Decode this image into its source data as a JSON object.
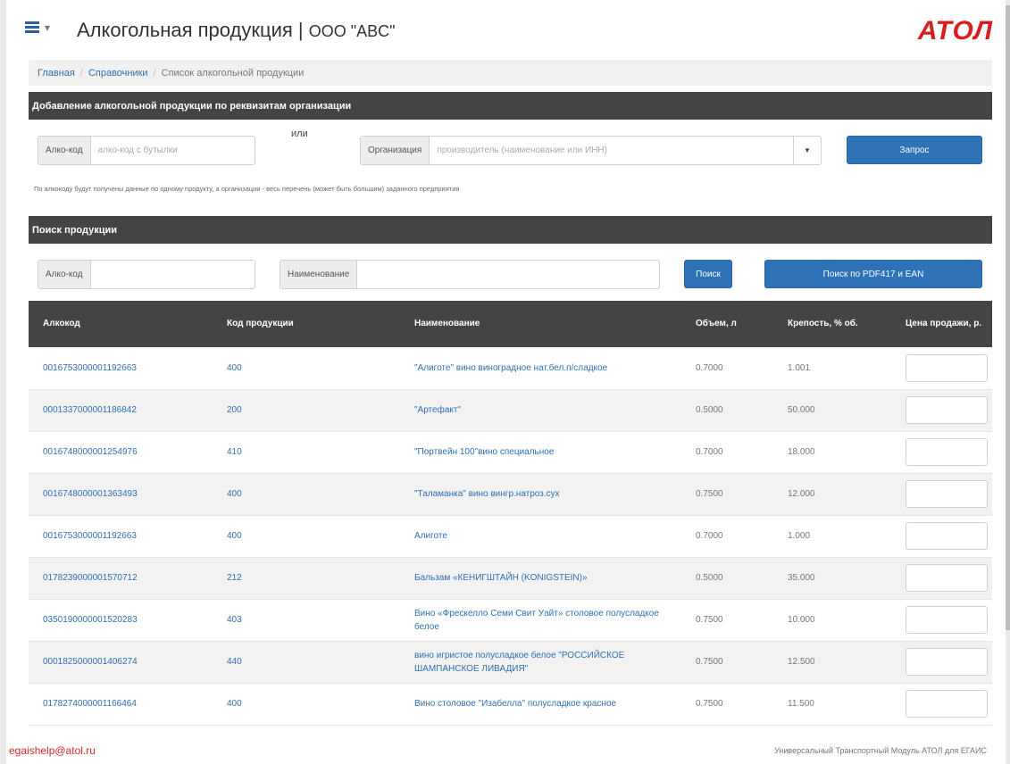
{
  "header": {
    "menu_chevron": "▾",
    "title": "Алкогольная продукция |",
    "org": "ООО \"ABC\"",
    "logo": "АТОЛ"
  },
  "breadcrumb": {
    "items": [
      "Главная",
      "Справочники",
      "Список алкогольной продукции"
    ],
    "separator": "/"
  },
  "add_section": {
    "title": "Добавление алкогольной продукции по реквизитам организации",
    "alco_label": "Алко-код",
    "alco_placeholder": "алко-код с бутылки",
    "or_text": "или",
    "org_label": "Организация",
    "org_placeholder": "производитель (наименование или ИНН)",
    "request_button": "Запрос",
    "hint": "По алкокоду будут получены данные по одному продукту, а организации - весь перечень (может быть большим) заданного предприятия"
  },
  "search_section": {
    "title": "Поиск продукции",
    "alco_label": "Алко-код",
    "alco_value": "",
    "name_label": "Наименование",
    "name_value": "",
    "search_button": "Поиск",
    "pdf_button": "Поиск по PDF417 и EAN"
  },
  "table": {
    "columns": [
      "Алкокод",
      "Код продукции",
      "Наименование",
      "Объем, л",
      "Крепость, % об.",
      "Цена продажи, р."
    ],
    "rows": [
      {
        "alcocode": "0016753000001192663",
        "code": "400",
        "name": "\"Алиготе\" вино виноградное нат.бел.п/сладкое",
        "volume": "0.7000",
        "strength": "1.001"
      },
      {
        "alcocode": "0001337000001186842",
        "code": "200",
        "name": "\"Артефакт\"",
        "volume": "0.5000",
        "strength": "50.000"
      },
      {
        "alcocode": "0016748000001254976",
        "code": "410",
        "name": "\"Портвейн 100\"вино специальное",
        "volume": "0.7000",
        "strength": "18.000"
      },
      {
        "alcocode": "0016748000001363493",
        "code": "400",
        "name": "\"Таламанка\" вино вингр.натроз.сух",
        "volume": "0.7500",
        "strength": "12.000"
      },
      {
        "alcocode": "0016753000001192663",
        "code": "400",
        "name": "Алиготе",
        "volume": "0.7000",
        "strength": "1.000"
      },
      {
        "alcocode": "0178239000001570712",
        "code": "212",
        "name": "Бальзам «КЕНИГШТАЙН (KONIGSTEIN)»",
        "volume": "0.5000",
        "strength": "35.000"
      },
      {
        "alcocode": "0350190000001520283",
        "code": "403",
        "name": "Вино «Фрескелло Семи Свит Уайт» столовое полусладкое белое",
        "volume": "0.7500",
        "strength": "10.000"
      },
      {
        "alcocode": "0001825000001406274",
        "code": "440",
        "name": "вино игристое полусладкое белое \"РОССИЙСКОЕ ШАМПАНСКОЕ ЛИВАДИЯ\"",
        "volume": "0.7500",
        "strength": "12.500"
      },
      {
        "alcocode": "0178274000001166464",
        "code": "400",
        "name": "Вино столовое \"Изабелла\" полусладкое красное",
        "volume": "0.7500",
        "strength": "11.500"
      }
    ]
  },
  "footer": {
    "email": "egaishelp@atol.ru",
    "product": "Универсальный Транспортный Модуль АТОЛ для ЕГАИС"
  },
  "colors": {
    "accent": "#2f72b8",
    "header_bar": "#444444",
    "logo": "#d61f1f",
    "link": "#2f6fb0"
  }
}
